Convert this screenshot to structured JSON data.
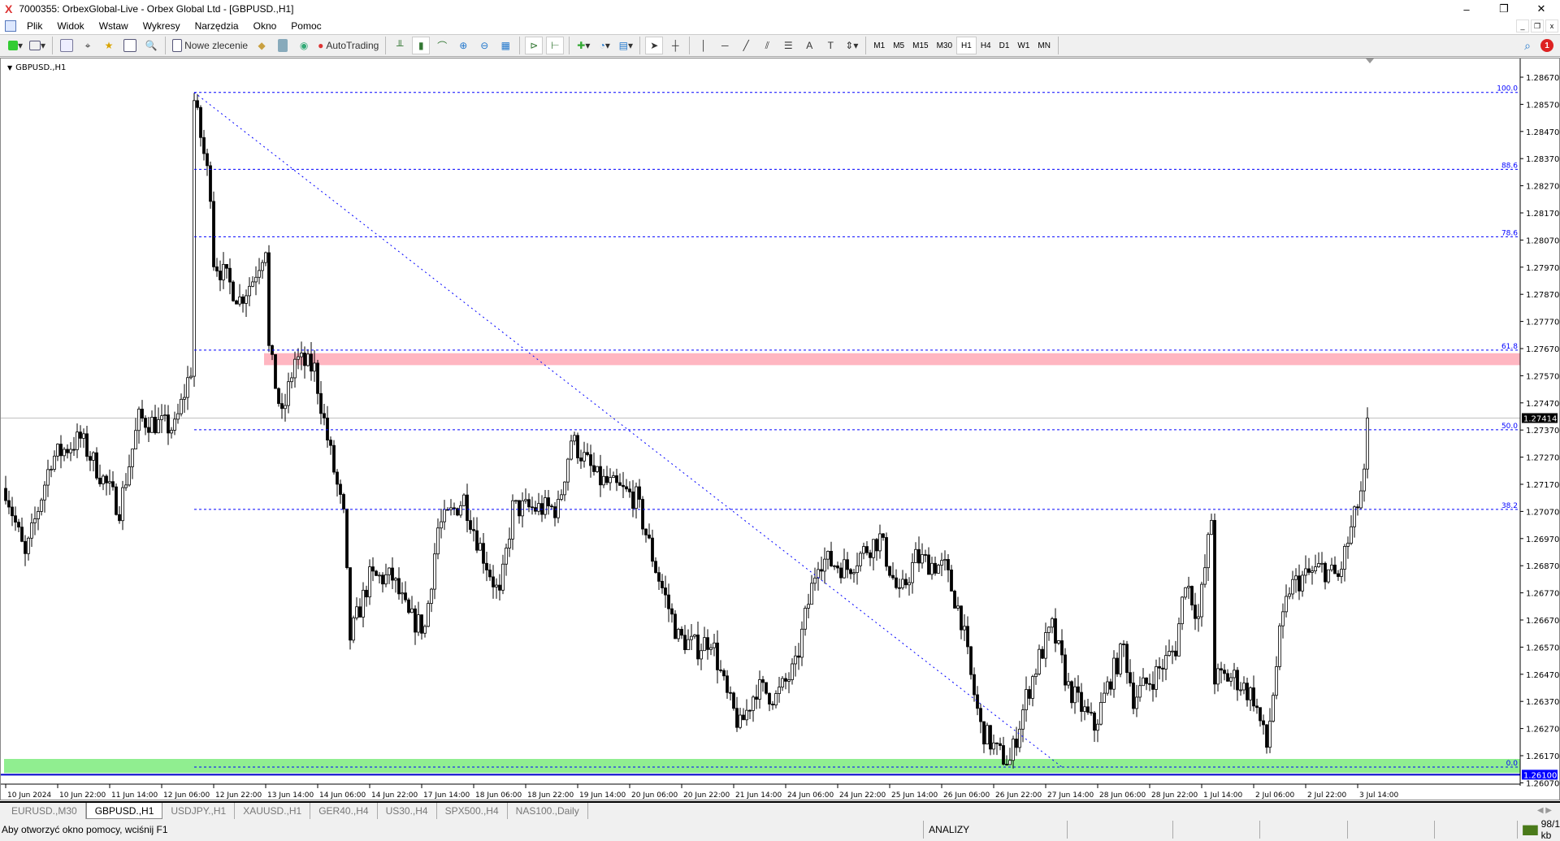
{
  "window": {
    "title": "7000355: OrbexGlobal-Live - Orbex Global Ltd - [GBPUSD.,H1]",
    "minimize": "–",
    "maximize": "❐",
    "close": "✕"
  },
  "menu": [
    "Plik",
    "Widok",
    "Wstaw",
    "Wykresy",
    "Narzędzia",
    "Okno",
    "Pomoc"
  ],
  "toolbar": {
    "new_order": "Nowe zlecenie",
    "autotrading": "AutoTrading",
    "timeframes": [
      "M1",
      "M5",
      "M15",
      "M30",
      "H1",
      "H4",
      "D1",
      "W1",
      "MN"
    ],
    "active_timeframe": "H1",
    "notification_count": "1"
  },
  "chart": {
    "symbol_label": "GBPUSD.,H1",
    "current_price": "1.27414",
    "line_price": "1.26100"
  },
  "chart_data": {
    "type": "candlestick",
    "symbol": "GBPUSD.",
    "timeframe": "H1",
    "y_ticks": [
      "1.28670",
      "1.28570",
      "1.28470",
      "1.28370",
      "1.28270",
      "1.28170",
      "1.28070",
      "1.27970",
      "1.27870",
      "1.27770",
      "1.27670",
      "1.27570",
      "1.27470",
      "1.27370",
      "1.27270",
      "1.27170",
      "1.27070",
      "1.26970",
      "1.26870",
      "1.26770",
      "1.26670",
      "1.26570",
      "1.26470",
      "1.26370",
      "1.26270",
      "1.26170",
      "1.26070"
    ],
    "ylim": [
      1.2605,
      1.2876
    ],
    "x_ticks": [
      "10 Jun 2024",
      "10 Jun 22:00",
      "11 Jun 14:00",
      "12 Jun 06:00",
      "12 Jun 22:00",
      "13 Jun 14:00",
      "14 Jun 06:00",
      "14 Jun 22:00",
      "17 Jun 14:00",
      "18 Jun 06:00",
      "18 Jun 22:00",
      "19 Jun 14:00",
      "20 Jun 06:00",
      "20 Jun 22:00",
      "21 Jun 14:00",
      "24 Jun 06:00",
      "24 Jun 22:00",
      "25 Jun 14:00",
      "26 Jun 06:00",
      "26 Jun 22:00",
      "27 Jun 14:00",
      "28 Jun 06:00",
      "28 Jun 22:00",
      "1 Jul 14:00",
      "2 Jul 06:00",
      "2 Jul 22:00",
      "3 Jul 14:00"
    ],
    "bars_per_tick": 16,
    "close_path": [
      [
        0,
        1.27155
      ],
      [
        6,
        1.26898
      ],
      [
        14,
        1.27265
      ],
      [
        23,
        1.27338
      ],
      [
        35,
        1.27081
      ],
      [
        41,
        1.27411
      ],
      [
        52,
        1.27375
      ],
      [
        57,
        1.27595
      ],
      [
        58,
        1.28584
      ],
      [
        63,
        1.28255
      ],
      [
        64,
        1.27998
      ],
      [
        72,
        1.27851
      ],
      [
        76,
        1.27925
      ],
      [
        80,
        1.28053
      ],
      [
        81,
        1.27668
      ],
      [
        85,
        1.27411
      ],
      [
        89,
        1.27631
      ],
      [
        95,
        1.27595
      ],
      [
        99,
        1.27338
      ],
      [
        104,
        1.27045
      ],
      [
        106,
        1.26605
      ],
      [
        112,
        1.26825
      ],
      [
        119,
        1.26825
      ],
      [
        124,
        1.26678
      ],
      [
        129,
        1.26641
      ],
      [
        133,
        1.27008
      ],
      [
        141,
        1.27118
      ],
      [
        145,
        1.26971
      ],
      [
        152,
        1.26751
      ],
      [
        156,
        1.27081
      ],
      [
        164,
        1.27081
      ],
      [
        170,
        1.27081
      ],
      [
        174,
        1.27338
      ],
      [
        182,
        1.27191
      ],
      [
        188,
        1.27155
      ],
      [
        194,
        1.27118
      ],
      [
        200,
        1.26861
      ],
      [
        207,
        1.26605
      ],
      [
        213,
        1.26568
      ],
      [
        217,
        1.26605
      ],
      [
        222,
        1.26385
      ],
      [
        226,
        1.26275
      ],
      [
        231,
        1.26421
      ],
      [
        237,
        1.26385
      ],
      [
        243,
        1.26495
      ],
      [
        246,
        1.26678
      ],
      [
        250,
        1.26898
      ],
      [
        259,
        1.26861
      ],
      [
        265,
        1.26935
      ],
      [
        269,
        1.26971
      ],
      [
        275,
        1.26751
      ],
      [
        280,
        1.26898
      ],
      [
        289,
        1.26861
      ],
      [
        294,
        1.26678
      ],
      [
        297,
        1.26458
      ],
      [
        300,
        1.26275
      ],
      [
        305,
        1.26183
      ],
      [
        309,
        1.26147
      ],
      [
        314,
        1.26385
      ],
      [
        318,
        1.26531
      ],
      [
        322,
        1.26641
      ],
      [
        327,
        1.26421
      ],
      [
        335,
        1.26275
      ],
      [
        340,
        1.26458
      ],
      [
        344,
        1.26568
      ],
      [
        347,
        1.26385
      ],
      [
        353,
        1.26458
      ],
      [
        360,
        1.26568
      ],
      [
        363,
        1.26825
      ],
      [
        367,
        1.26678
      ],
      [
        371,
        1.27045
      ],
      [
        372,
        1.26458
      ],
      [
        378,
        1.26458
      ],
      [
        384,
        1.26385
      ],
      [
        388,
        1.26201
      ],
      [
        392,
        1.26605
      ],
      [
        395,
        1.26788
      ],
      [
        399,
        1.26825
      ],
      [
        405,
        1.26861
      ],
      [
        410,
        1.26825
      ],
      [
        415,
        1.27045
      ],
      [
        418,
        1.27191
      ],
      [
        419,
        1.27414
      ]
    ],
    "fibonacci": {
      "start_bar": 58,
      "high": 1.28614,
      "low": 1.26128,
      "levels": [
        "100.0",
        "88.6",
        "78.6",
        "61.8",
        "50.0",
        "38.2",
        "0.0"
      ]
    },
    "trendline": {
      "from": [
        58,
        1.28614
      ],
      "to": [
        325,
        1.26128
      ]
    },
    "zones": [
      {
        "name": "resistance",
        "from_bar": 80,
        "top": 1.27653,
        "bottom": 1.27609,
        "color": "#ffb6c1"
      },
      {
        "name": "support",
        "from_bar": 0,
        "top": 1.26158,
        "bottom": 1.26106,
        "color": "#90ee90"
      }
    ],
    "hline": 1.261,
    "bid": 1.27414
  },
  "tabs": [
    "EURUSD.,M30",
    "GBPUSD.,H1",
    "USDJPY.,H1",
    "XAUUSD.,H1",
    "GER40.,H4",
    "US30.,H4",
    "SPX500.,H4",
    "NAS100.,Daily"
  ],
  "active_tab": 1,
  "status": {
    "help": "Aby otworzyć okno pomocy, wciśnij F1",
    "profile": "ANALIZY",
    "traffic": "98/1 kb"
  },
  "colors": {
    "fib": "#0000ff",
    "bull": "#ffffff",
    "bear": "#000000"
  }
}
